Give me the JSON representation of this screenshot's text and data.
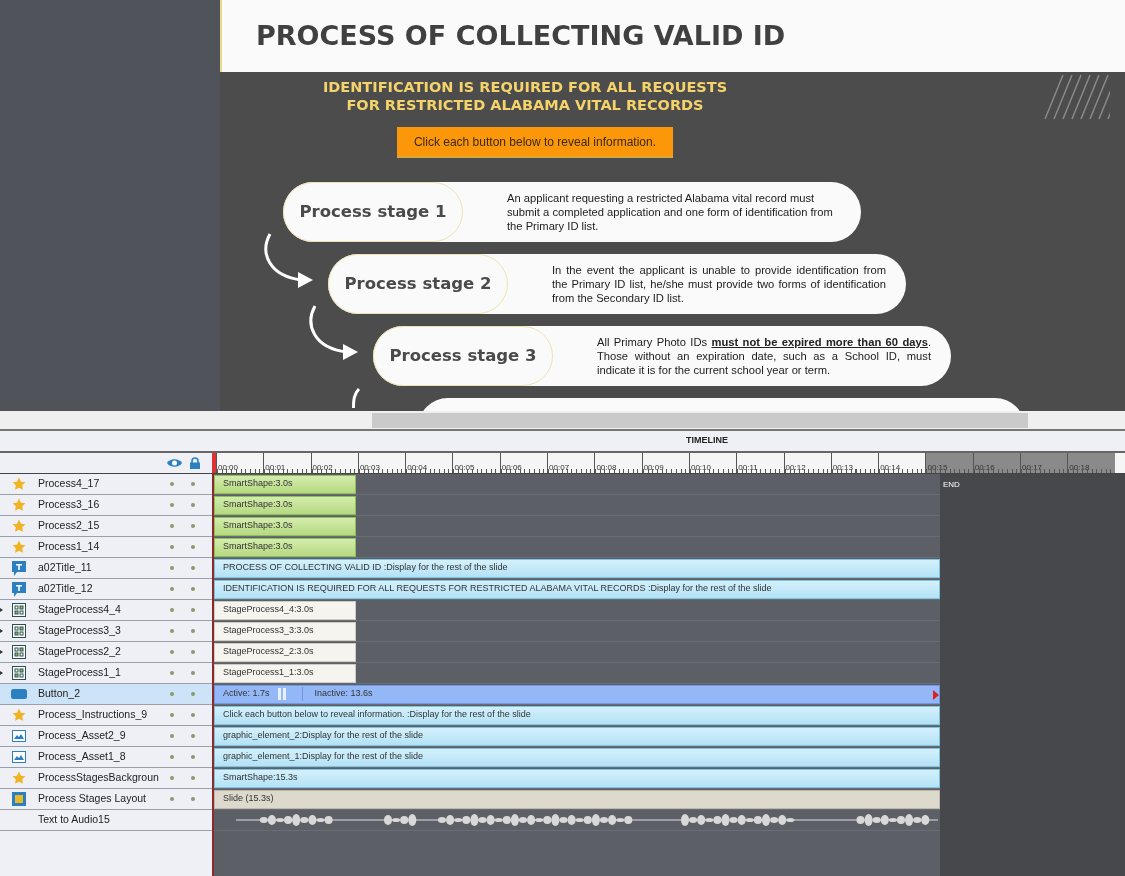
{
  "slide": {
    "title": "PROCESS OF COLLECTING VALID ID",
    "heading_lines": [
      "IDENTIFICATION IS REQUIRED FOR ALL REQUESTS",
      "FOR RESTRICTED ALABAMA VITAL RECORDS"
    ],
    "instruction": "Click each button below to reveal information.",
    "stages": [
      {
        "label": "Process stage 1",
        "text": "An applicant requesting a restricted Alabama vital record must submit a completed application and one form of identification from the Primary ID list.",
        "justify": false
      },
      {
        "label": "Process stage 2",
        "text": "In the event the applicant is unable to provide identification from the Primary ID list, he/she must provide two forms of identification from the Secondary ID list.",
        "justify": true
      },
      {
        "label": "Process stage 3",
        "text": "All Primary Photo IDs **must not be expired more than 60 days**. Those without an expiration date, such as a School ID, must indicate it is for the current school year or term.",
        "justify": true
      },
      {
        "kind": "cut"
      }
    ]
  },
  "timeline": {
    "title": "TIMELINE",
    "end_label": "END",
    "ticks": [
      "00:00",
      "00:01",
      "00:02",
      "00:03",
      "00:04",
      "00:05",
      "00:06",
      "00:07",
      "00:08",
      "00:09",
      "00:10",
      "00:11",
      "00:12",
      "00:13",
      "00:14",
      "00:15",
      "00:16",
      "00:17",
      "00:18"
    ],
    "layers": [
      {
        "name": "Process4_17",
        "kind": "star",
        "selected": false,
        "bar": {
          "kind": "shape",
          "label": "SmartShape:3.0s"
        }
      },
      {
        "name": "Process3_16",
        "kind": "star",
        "selected": false,
        "bar": {
          "kind": "shape",
          "label": "SmartShape:3.0s"
        }
      },
      {
        "name": "Process2_15",
        "kind": "star",
        "selected": false,
        "bar": {
          "kind": "shape",
          "label": "SmartShape:3.0s"
        }
      },
      {
        "name": "Process1_14",
        "kind": "star",
        "selected": false,
        "bar": {
          "kind": "shape",
          "label": "SmartShape:3.0s"
        }
      },
      {
        "name": "a02Title_11",
        "kind": "text",
        "selected": false,
        "bar": {
          "kind": "text",
          "label": "PROCESS OF COLLECTING VALID ID :Display for the rest of the slide"
        }
      },
      {
        "name": "a02Title_12",
        "kind": "text",
        "selected": false,
        "bar": {
          "kind": "text",
          "label": "IDENTIFICATION IS REQUIRED FOR ALL REQUESTS  FOR RESTRICTED ALABAMA VITAL RECORDS :Display for the rest of the slide"
        }
      },
      {
        "name": "StageProcess4_4",
        "kind": "group",
        "selected": false,
        "bar": {
          "kind": "group",
          "label": "StageProcess4_4:3.0s"
        }
      },
      {
        "name": "StageProcess3_3",
        "kind": "group",
        "selected": false,
        "bar": {
          "kind": "group",
          "label": "StageProcess3_3:3.0s"
        }
      },
      {
        "name": "StageProcess2_2",
        "kind": "group",
        "selected": false,
        "bar": {
          "kind": "group",
          "label": "StageProcess2_2:3.0s"
        }
      },
      {
        "name": "StageProcess1_1",
        "kind": "group",
        "selected": false,
        "bar": {
          "kind": "group",
          "label": "StageProcess1_1:3.0s"
        }
      },
      {
        "name": "Button_2",
        "kind": "button",
        "selected": true,
        "bar": {
          "kind": "button",
          "label": "Active: 1.7s",
          "second_label": "Inactive: 13.6s"
        }
      },
      {
        "name": "Process_Instructions_9",
        "kind": "star",
        "selected": false,
        "bar": {
          "kind": "text",
          "label": "Click each button below to reveal information. :Display for the rest of the slide"
        }
      },
      {
        "name": "Process_Asset2_9",
        "kind": "image",
        "selected": false,
        "bar": {
          "kind": "text",
          "label": "graphic_element_2:Display for the rest of the slide"
        }
      },
      {
        "name": "Process_Asset1_8",
        "kind": "image",
        "selected": false,
        "bar": {
          "kind": "text",
          "label": "graphic_element_1:Display for the rest of the slide"
        }
      },
      {
        "name": "ProcessStagesBackgroun",
        "kind": "star",
        "selected": false,
        "bar": {
          "kind": "text",
          "label": "SmartShape:15.3s"
        }
      },
      {
        "name": "Process Stages Layout",
        "kind": "layout",
        "selected": false,
        "bar": {
          "kind": "slide",
          "label": "Slide (15.3s)"
        }
      },
      {
        "name": "Text to Audio15",
        "kind": "audio",
        "selected": false,
        "bar": {
          "kind": "audio"
        }
      }
    ]
  }
}
